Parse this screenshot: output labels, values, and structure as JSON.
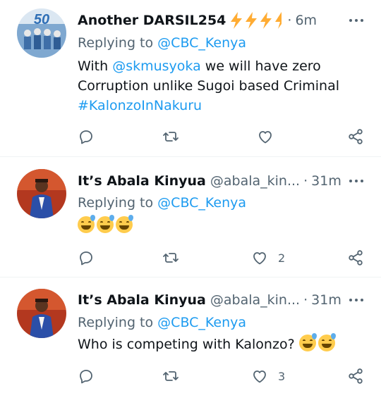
{
  "tweets": [
    {
      "display_name": "Another DARSIL254",
      "handle": "",
      "time": "6m",
      "replying_prefix": "Replying to",
      "replying_to": "@CBC_Kenya",
      "text_part1": "With",
      "mention": "@skmusyoka",
      "text_part2": "we will have zero",
      "text_line2": "Corruption unlike Sugoi based Criminal",
      "hashtag": "#KalonzoInNakuru",
      "likes": "",
      "avatar_badge": "50"
    },
    {
      "display_name": "It’s Abala Kinyua",
      "handle": "@abala_kin...",
      "time": "31m",
      "replying_prefix": "Replying to",
      "replying_to": "@CBC_Kenya",
      "likes": "2"
    },
    {
      "display_name": "It’s Abala Kinyua",
      "handle": "@abala_kin...",
      "time": "31m",
      "replying_prefix": "Replying to",
      "replying_to": "@CBC_Kenya",
      "text": "Who is competing with Kalonzo?",
      "likes": "3"
    }
  ],
  "separator": "·",
  "icons": {
    "reply": "reply-icon",
    "retweet": "retweet-icon",
    "like": "heart-icon",
    "share": "share-icon",
    "more": "more-icon",
    "emoji": "grinning-sweat-emoji-icon",
    "bolt": "high-voltage-emoji-icon"
  },
  "colors": {
    "link": "#1d9bf0",
    "muted": "#536471",
    "text": "#0f1419"
  }
}
